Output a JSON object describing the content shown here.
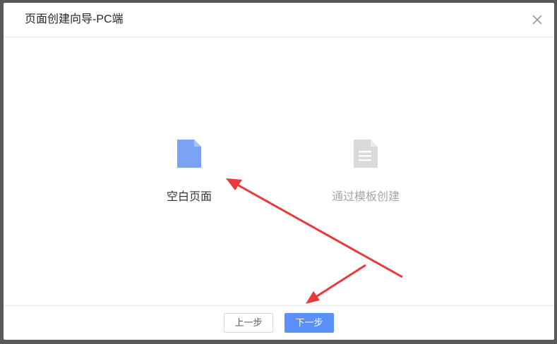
{
  "dialog": {
    "title": "页面创建向导-PC端",
    "close_icon": "close-icon"
  },
  "options": [
    {
      "label": "空白页面",
      "icon": "document-icon",
      "color": "#7aa3f5",
      "selected": true
    },
    {
      "label": "通过模板创建",
      "icon": "document-lines-icon",
      "color": "#d9d9d9",
      "selected": false
    }
  ],
  "footer": {
    "prev_label": "上一步",
    "next_label": "下一步"
  },
  "colors": {
    "primary": "#5b8ff9",
    "annotation_arrow": "#e8393b"
  }
}
